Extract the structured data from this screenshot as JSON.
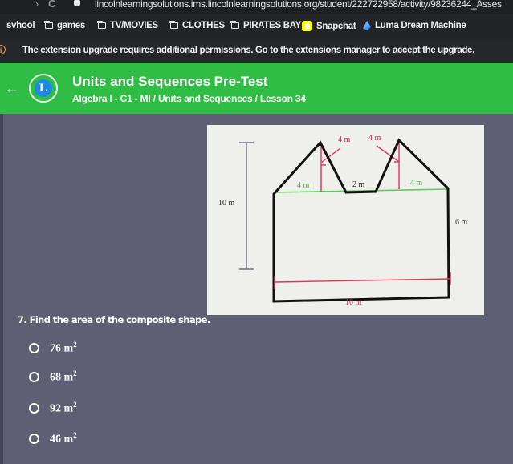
{
  "browser": {
    "url": "lincolnlearningsolutions.ims.lincolnlearningsolutions.org/student/222722958/activity/98236244_Asses",
    "back_glyph": "›",
    "reload_glyph": "C",
    "bookmarks": [
      {
        "label": "svhool",
        "icon": "none"
      },
      {
        "label": "games",
        "icon": "folder-icon"
      },
      {
        "label": "TV/MOVIES",
        "icon": "folder-icon"
      },
      {
        "label": "CLOTHES",
        "icon": "folder-icon"
      },
      {
        "label": "PIRATES BAY",
        "icon": "folder-icon"
      },
      {
        "label": "Snapchat",
        "icon": "snapchat-icon"
      },
      {
        "label": "Luma Dream Machine",
        "icon": "luma-icon"
      }
    ]
  },
  "notice": {
    "icon": "info-icon",
    "info_glyph": "i",
    "message": "The extension upgrade requires additional permissions. Go to the extensions manager to accept the upgrade."
  },
  "header": {
    "back_glyph": "←",
    "logo_letter": "L",
    "title": "Units and Sequences Pre-Test",
    "breadcrumb": "Algebra I - C1 - MI / Units and Sequences / Lesson 34",
    "color": "#2fbd45"
  },
  "diagram": {
    "labels": {
      "slant_left": "4 m",
      "slant_right": "4 m",
      "base_left": "4 m",
      "gap": "2 m",
      "base_right": "4 m",
      "total_height": "10 m",
      "rect_height": "6 m",
      "width": "10 m"
    },
    "colors": {
      "outline": "#111111",
      "height_marks": "#e0335a",
      "base_line": "#5fcf5a",
      "dimension": "#7a7a8a"
    }
  },
  "question": {
    "number": "7.",
    "text": "Find the area of the composite shape.",
    "options": [
      {
        "value": "76",
        "unit": "m",
        "exp": "2"
      },
      {
        "value": "68",
        "unit": "m",
        "exp": "2"
      },
      {
        "value": "92",
        "unit": "m",
        "exp": "2"
      },
      {
        "value": "46",
        "unit": "m",
        "exp": "2"
      }
    ]
  }
}
